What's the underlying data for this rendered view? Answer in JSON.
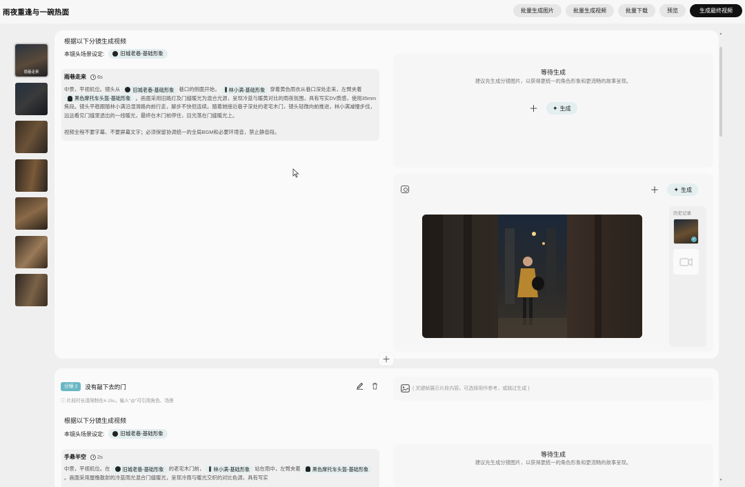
{
  "app": {
    "title": "雨夜重逢与一碗热面"
  },
  "toolbar": {
    "buttons": [
      "批量生成图片",
      "批量生成视频",
      "批量下载",
      "预览",
      "生成最终视频"
    ]
  },
  "sidebar": {
    "thumbs": [
      {
        "label": "雨巷走来"
      },
      {
        "label": ""
      },
      {
        "label": ""
      },
      {
        "label": ""
      },
      {
        "label": ""
      },
      {
        "label": ""
      },
      {
        "label": ""
      }
    ]
  },
  "shot1": {
    "section_title": "根据以下分镜生成视频",
    "scene_label": "本镜头场景设定:",
    "scene_chip": "旧城老巷-基础形象",
    "shot_name": "雨巷走来",
    "duration": "6s",
    "prompt": {
      "p1": "中景，平视机位。镜头从",
      "chip1": "旧城老巷-基础形象",
      "p2": "巷口的侧面开始，",
      "chip2": "林小满-基础形象",
      "p3": "穿着黄色雨衣从巷口深处走来，左臂夹着",
      "chip3": "黑色摩托车头盔-基础形象",
      "p4": "。画面采用旧路灯及门缝暖光为混合光源，呈现冷蓝与暖黄对比的雨夜氛围，具有写实DV质感，使用35mm焦段。镜头平稳跟随林小满沿湿滑路向前行走，脚步不快但连续。随着她接近巷子深处的老宅木门，镜头轻微向前推进，林小满减慢步伐，远远看见门缝里透出的一线暖光，最终在木门前停住，目光落在门缝暖光上。",
      "p5": "视频全程不要字幕、不要屏幕文字；必须保留协调统一的全局BGM和必要环境音，禁止静音段。"
    },
    "waiting": {
      "title": "等待生成",
      "sub": "建议先生成分镜图片，以获得更统一的角色形象和更流畅的故事呈现。",
      "gen_label": "生成"
    },
    "video": {
      "gen_label": "生成",
      "history_label": "历史记录"
    }
  },
  "shot2": {
    "badge": "分镜 2",
    "title": "没有敲下去的门",
    "info": "片段时长请限制在4-15s，输入\"@\"可引用角色、场景",
    "image_prompt_placeholder": "( 关键帧展示片段内容。可选择用作参考，或跳过生成 )",
    "section_title": "根据以下分镜生成视频",
    "scene_label": "本镜头场景设定:",
    "scene_chip": "旧城老巷-基础形象",
    "shot_name": "手悬半空",
    "duration": "2s",
    "prompt": {
      "p1": "中景，平视机位。在",
      "chip1": "旧城老巷-基础形象",
      "p2": "的老宅木门前，",
      "chip2": "林小满-基础形象",
      "p3": "站在雨中，左臂夹着",
      "chip3": "黑色摩托车头盔-基础形象",
      "p4": "。画面采用屋檐散射的冷蓝雨光混合门缝暖光，呈现冷雨与暖光交织的对比色调，具有写实"
    },
    "waiting": {
      "title": "等待生成",
      "sub": "建议先生成分镜图片，以获得更统一的角色形象和更流畅的故事呈现。"
    }
  },
  "colors": {
    "accent": "#69b7c4",
    "chip_bg": "#e3eeef",
    "primary_btn": "#111111"
  }
}
